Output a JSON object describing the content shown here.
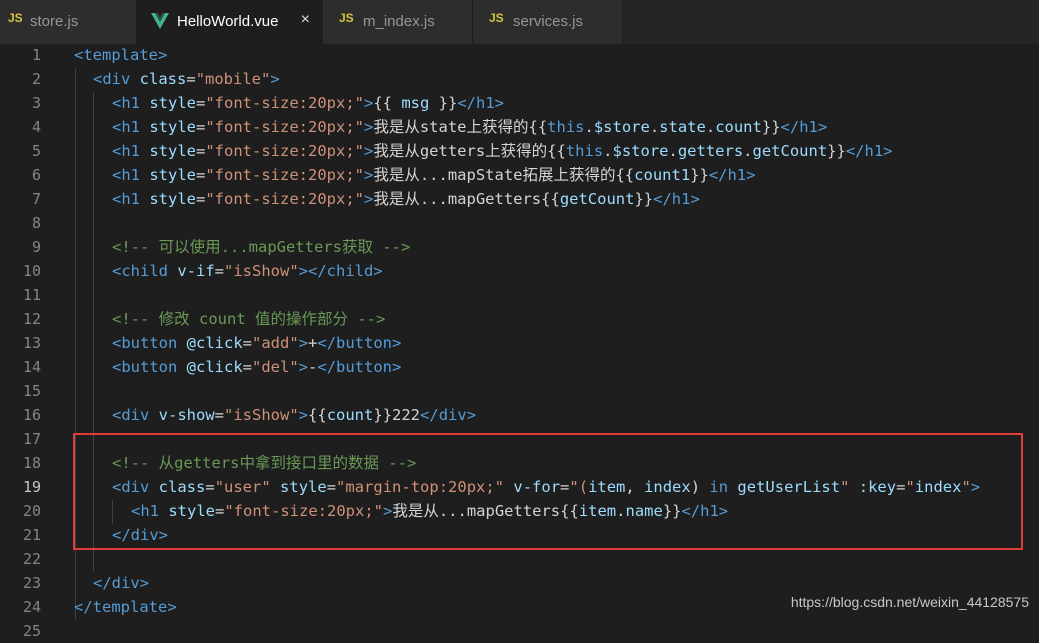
{
  "tabs": [
    {
      "icon": "JS",
      "label": "store.js",
      "active": false
    },
    {
      "icon": "vue",
      "label": "HelloWorld.vue",
      "active": true,
      "close": "×"
    },
    {
      "icon": "JS",
      "label": "m_index.js",
      "active": false
    },
    {
      "icon": "JS",
      "label": "services.js",
      "active": false
    }
  ],
  "editor": {
    "current_line": 19,
    "lines": [
      {
        "n": 1,
        "indent": 0,
        "tokens": [
          [
            "tag",
            "<template>"
          ]
        ]
      },
      {
        "n": 2,
        "indent": 1,
        "tokens": [
          [
            "tag",
            "<div "
          ],
          [
            "attr",
            "class"
          ],
          [
            "text",
            "="
          ],
          [
            "str",
            "\"mobile\""
          ],
          [
            "tag",
            ">"
          ]
        ]
      },
      {
        "n": 3,
        "indent": 2,
        "tokens": [
          [
            "tag",
            "<h1 "
          ],
          [
            "attr",
            "style"
          ],
          [
            "text",
            "="
          ],
          [
            "str",
            "\"font-size:20px;\""
          ],
          [
            "tag",
            ">"
          ],
          [
            "text",
            "{{ "
          ],
          [
            "expr",
            "msg"
          ],
          [
            "text",
            " }}"
          ],
          [
            "tag",
            "</h1>"
          ]
        ]
      },
      {
        "n": 4,
        "indent": 2,
        "tokens": [
          [
            "tag",
            "<h1 "
          ],
          [
            "attr",
            "style"
          ],
          [
            "text",
            "="
          ],
          [
            "str",
            "\"font-size:20px;\""
          ],
          [
            "tag",
            ">"
          ],
          [
            "text",
            "我是从state上获得的{{"
          ],
          [
            "kw",
            "this"
          ],
          [
            "text",
            "."
          ],
          [
            "expr",
            "$store"
          ],
          [
            "text",
            "."
          ],
          [
            "expr",
            "state"
          ],
          [
            "text",
            "."
          ],
          [
            "expr",
            "count"
          ],
          [
            "text",
            "}}"
          ],
          [
            "tag",
            "</h1>"
          ]
        ]
      },
      {
        "n": 5,
        "indent": 2,
        "tokens": [
          [
            "tag",
            "<h1 "
          ],
          [
            "attr",
            "style"
          ],
          [
            "text",
            "="
          ],
          [
            "str",
            "\"font-size:20px;\""
          ],
          [
            "tag",
            ">"
          ],
          [
            "text",
            "我是从getters上获得的{{"
          ],
          [
            "kw",
            "this"
          ],
          [
            "text",
            "."
          ],
          [
            "expr",
            "$store"
          ],
          [
            "text",
            "."
          ],
          [
            "expr",
            "getters"
          ],
          [
            "text",
            "."
          ],
          [
            "expr",
            "getCount"
          ],
          [
            "text",
            "}}"
          ],
          [
            "tag",
            "</h1>"
          ]
        ]
      },
      {
        "n": 6,
        "indent": 2,
        "tokens": [
          [
            "tag",
            "<h1 "
          ],
          [
            "attr",
            "style"
          ],
          [
            "text",
            "="
          ],
          [
            "str",
            "\"font-size:20px;\""
          ],
          [
            "tag",
            ">"
          ],
          [
            "text",
            "我是从...mapState拓展上获得的{{"
          ],
          [
            "expr",
            "count1"
          ],
          [
            "text",
            "}}"
          ],
          [
            "tag",
            "</h1>"
          ]
        ]
      },
      {
        "n": 7,
        "indent": 2,
        "tokens": [
          [
            "tag",
            "<h1 "
          ],
          [
            "attr",
            "style"
          ],
          [
            "text",
            "="
          ],
          [
            "str",
            "\"font-size:20px;\""
          ],
          [
            "tag",
            ">"
          ],
          [
            "text",
            "我是从...mapGetters{{"
          ],
          [
            "expr",
            "getCount"
          ],
          [
            "text",
            "}}"
          ],
          [
            "tag",
            "</h1>"
          ]
        ]
      },
      {
        "n": 8,
        "indent": 0,
        "tokens": []
      },
      {
        "n": 9,
        "indent": 2,
        "tokens": [
          [
            "comment",
            "<!-- 可以使用...mapGetters获取 -->"
          ]
        ]
      },
      {
        "n": 10,
        "indent": 2,
        "tokens": [
          [
            "tag",
            "<child "
          ],
          [
            "attr",
            "v-if"
          ],
          [
            "text",
            "="
          ],
          [
            "str",
            "\"isShow\""
          ],
          [
            "tag",
            "></child>"
          ]
        ]
      },
      {
        "n": 11,
        "indent": 0,
        "tokens": []
      },
      {
        "n": 12,
        "indent": 2,
        "tokens": [
          [
            "comment",
            "<!-- 修改 count 值的操作部分 -->"
          ]
        ]
      },
      {
        "n": 13,
        "indent": 2,
        "tokens": [
          [
            "tag",
            "<button "
          ],
          [
            "attr",
            "@click"
          ],
          [
            "text",
            "="
          ],
          [
            "str",
            "\"add\""
          ],
          [
            "tag",
            ">"
          ],
          [
            "text",
            "+"
          ],
          [
            "tag",
            "</button>"
          ]
        ]
      },
      {
        "n": 14,
        "indent": 2,
        "tokens": [
          [
            "tag",
            "<button "
          ],
          [
            "attr",
            "@click"
          ],
          [
            "text",
            "="
          ],
          [
            "str",
            "\"del\""
          ],
          [
            "tag",
            ">"
          ],
          [
            "text",
            "-"
          ],
          [
            "tag",
            "</button>"
          ]
        ]
      },
      {
        "n": 15,
        "indent": 0,
        "tokens": []
      },
      {
        "n": 16,
        "indent": 2,
        "tokens": [
          [
            "tag",
            "<div "
          ],
          [
            "attr",
            "v-show"
          ],
          [
            "text",
            "="
          ],
          [
            "str",
            "\"isShow\""
          ],
          [
            "tag",
            ">"
          ],
          [
            "text",
            "{{"
          ],
          [
            "expr",
            "count"
          ],
          [
            "text",
            "}}222"
          ],
          [
            "tag",
            "</div>"
          ]
        ]
      },
      {
        "n": 17,
        "indent": 0,
        "tokens": []
      },
      {
        "n": 18,
        "indent": 2,
        "tokens": [
          [
            "comment",
            "<!-- 从getters中拿到接口里的数据 -->"
          ]
        ]
      },
      {
        "n": 19,
        "indent": 2,
        "tokens": [
          [
            "tag",
            "<div "
          ],
          [
            "attr",
            "class"
          ],
          [
            "text",
            "="
          ],
          [
            "str",
            "\"user\""
          ],
          [
            "text",
            " "
          ],
          [
            "attr",
            "style"
          ],
          [
            "text",
            "="
          ],
          [
            "str",
            "\"margin-top:20px;\""
          ],
          [
            "text",
            " "
          ],
          [
            "attr",
            "v-for"
          ],
          [
            "text",
            "="
          ],
          [
            "str",
            "\"("
          ],
          [
            "expr",
            "item"
          ],
          [
            "text",
            ", "
          ],
          [
            "expr",
            "index"
          ],
          [
            "text",
            ") "
          ],
          [
            "kw",
            "in"
          ],
          [
            "text",
            " "
          ],
          [
            "expr",
            "getUserList"
          ],
          [
            "str",
            "\""
          ],
          [
            "text",
            " "
          ],
          [
            "attr",
            ":key"
          ],
          [
            "text",
            "="
          ],
          [
            "str",
            "\""
          ],
          [
            "expr",
            "index"
          ],
          [
            "str",
            "\""
          ],
          [
            "tag",
            ">"
          ]
        ]
      },
      {
        "n": 20,
        "indent": 3,
        "tokens": [
          [
            "tag",
            "<h1 "
          ],
          [
            "attr",
            "style"
          ],
          [
            "text",
            "="
          ],
          [
            "str",
            "\"font-size:20px;\""
          ],
          [
            "tag",
            ">"
          ],
          [
            "text",
            "我是从...mapGetters{{"
          ],
          [
            "expr",
            "item"
          ],
          [
            "text",
            "."
          ],
          [
            "expr",
            "name"
          ],
          [
            "text",
            "}}"
          ],
          [
            "tag",
            "</h1>"
          ]
        ]
      },
      {
        "n": 21,
        "indent": 2,
        "tokens": [
          [
            "tag",
            "</div>"
          ]
        ]
      },
      {
        "n": 22,
        "indent": 0,
        "tokens": []
      },
      {
        "n": 23,
        "indent": 1,
        "tokens": [
          [
            "tag",
            "</div>"
          ]
        ]
      },
      {
        "n": 24,
        "indent": 0,
        "tokens": [
          [
            "tag",
            "</template>"
          ]
        ]
      },
      {
        "n": 25,
        "indent": 0,
        "tokens": []
      }
    ]
  },
  "watermark": "https://blog.csdn.net/weixin_44128575",
  "colors": {
    "tag": "#569cd6",
    "attr": "#9cdcfe",
    "string": "#ce9178",
    "comment": "#6a9955",
    "highlight_box": "#e03c3c"
  }
}
